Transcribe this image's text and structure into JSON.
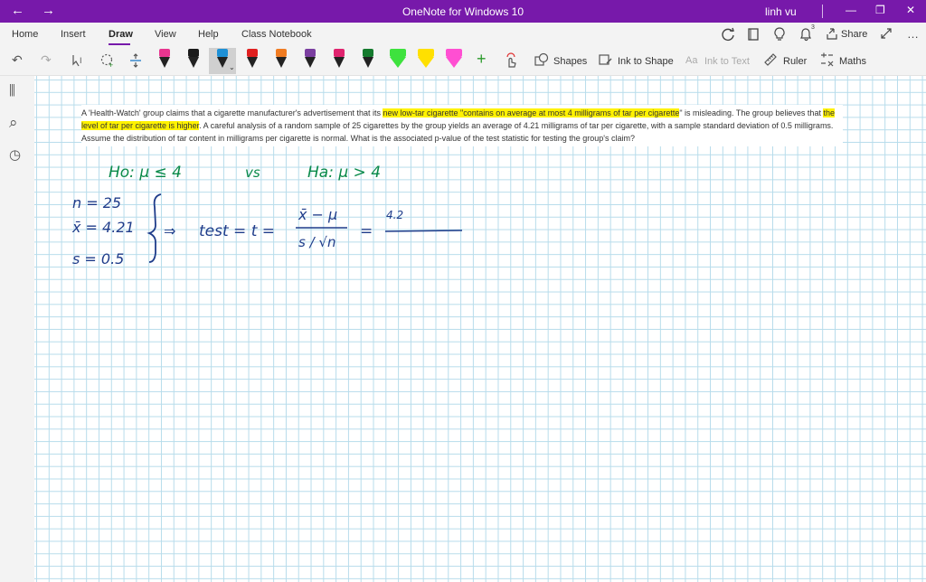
{
  "titlebar": {
    "back_glyph": "←",
    "forward_glyph": "→",
    "title": "OneNote for Windows 10",
    "user": "linh vu",
    "minimize_glyph": "—",
    "maximize_glyph": "❐",
    "close_glyph": "✕"
  },
  "menu": {
    "tabs": [
      "Home",
      "Insert",
      "Draw",
      "View",
      "Help",
      "Class Notebook"
    ],
    "active_tab": "Draw",
    "share_label": "Share",
    "icons": [
      "sync-icon",
      "notebook-icon",
      "lightbulb-icon",
      "bell-icon",
      "share-icon",
      "expand-icon",
      "more-icon"
    ],
    "bell_count": "3"
  },
  "toolbar": {
    "undo_glyph": "↶",
    "redo_glyph": "↷",
    "shapes_label": "Shapes",
    "ink_to_shape_label": "Ink to Shape",
    "ink_to_text_label": "Ink to Text",
    "ruler_label": "Ruler",
    "maths_label": "Maths",
    "add_pen_glyph": "+",
    "pens": [
      {
        "name": "pen-pink",
        "color": "#e8358f"
      },
      {
        "name": "pen-black",
        "color": "#1a1a1a"
      },
      {
        "name": "pen-blue",
        "color": "#1e90d6"
      },
      {
        "name": "pen-red",
        "color": "#e02020"
      },
      {
        "name": "pen-orange",
        "color": "#f07c22"
      },
      {
        "name": "pen-purple",
        "color": "#7b3fa0"
      },
      {
        "name": "pen-magenta",
        "color": "#e0246f"
      },
      {
        "name": "pen-darkred",
        "color": "#b01818"
      },
      {
        "name": "pen-darkgreen",
        "color": "#157a2e"
      },
      {
        "name": "highlighter-green",
        "color": "#3ee23e"
      },
      {
        "name": "highlighter-yellow",
        "color": "#ffe000"
      },
      {
        "name": "highlighter-pink",
        "color": "#ff4fd2"
      }
    ]
  },
  "sidebar": {
    "icons": [
      "notebooks-icon",
      "search-icon",
      "recent-icon"
    ],
    "notebooks_glyph": "⫼",
    "search_glyph": "⌕",
    "recent_glyph": "◷"
  },
  "note": {
    "q_part1": "A 'Health-Watch' group claims that a cigarette manufacturer's advertisement that its ",
    "q_hl1": "new low-tar cigarette \"contains on average at most 4 milligrams of tar per cigarette",
    "q_part2": "\" is misleading. The group believes that ",
    "q_hl2": "the level of tar per cigarette is higher",
    "q_part3": ". A careful analysis of a random sample of 25 cigarettes by the group yields an average of 4.21 milligrams of tar per cigarette, with a sample standard deviation of 0.5 milligrams. Assume the distribution of tar content in milligrams per cigarette is normal. What is the associated p-value of the test statistic for testing the group's claim?"
  },
  "ink": {
    "green_color": "#0a8a4a",
    "blue_color": "#1f3c8a",
    "h0": "Ho: μ ≤ 4",
    "vs": "vs",
    "ha": "Ha: μ > 4",
    "n_line": "n = 25",
    "xbar_line": "x̄ = 4.21",
    "s_line": "s = 0.5",
    "implies": "⇒",
    "test_eq": "test = t =",
    "numerator": "x̄ − μ",
    "denominator": "s / √n",
    "equals": "=",
    "partial_num": "4.2"
  }
}
